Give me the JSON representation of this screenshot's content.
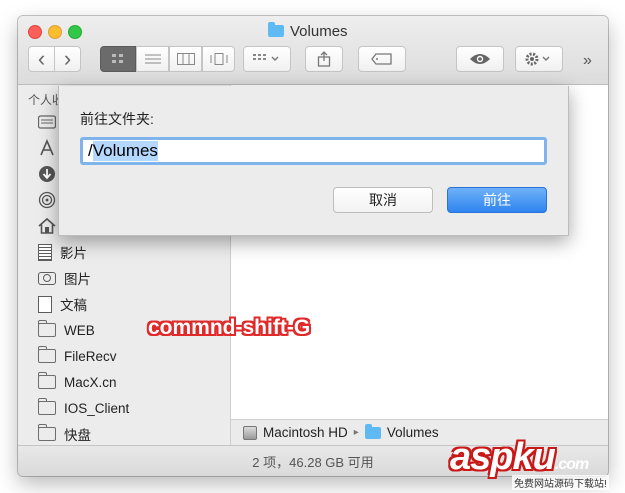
{
  "window": {
    "title": "Volumes",
    "title_icon": "folder-icon"
  },
  "toolbar": {
    "back_glyph": "‹",
    "forward_glyph": "›",
    "overflow_glyph": "»",
    "view_modes": [
      "icon-view",
      "list-view",
      "column-view",
      "cover-flow-view"
    ],
    "active_view": "icon-view"
  },
  "sidebar": {
    "heading": "个人收",
    "items": [
      {
        "label": "",
        "icon": "all-files-icon"
      },
      {
        "label": "",
        "icon": "applications-icon"
      },
      {
        "label": "",
        "icon": "downloads-icon"
      },
      {
        "label": "",
        "icon": "airdrop-icon"
      },
      {
        "label": "",
        "icon": "home-icon"
      },
      {
        "label": "影片",
        "icon": "film-icon"
      },
      {
        "label": "图片",
        "icon": "camera-icon"
      },
      {
        "label": "文稿",
        "icon": "document-icon"
      },
      {
        "label": "WEB",
        "icon": "folder-icon"
      },
      {
        "label": "FileRecv",
        "icon": "folder-icon"
      },
      {
        "label": "MacX.cn",
        "icon": "folder-icon"
      },
      {
        "label": "IOS_Client",
        "icon": "folder-icon"
      },
      {
        "label": "快盘",
        "icon": "folder-icon"
      }
    ]
  },
  "dialog": {
    "label": "前往文件夹:",
    "input_prefix": "/",
    "input_selected": "Volumes",
    "cancel_label": "取消",
    "go_label": "前往",
    "accent_color": "#3a8ff2"
  },
  "pathbar": {
    "segments": [
      "Macintosh HD",
      "Volumes"
    ],
    "separator": "▸"
  },
  "status": {
    "text": "2 项，46.28 GB 可用"
  },
  "annotation": {
    "text": "commnd-shift-G",
    "color": "#e02a2a"
  },
  "watermark": {
    "main": "aspku",
    "tld": ".com",
    "sub": "免费网站源码下载站!"
  }
}
